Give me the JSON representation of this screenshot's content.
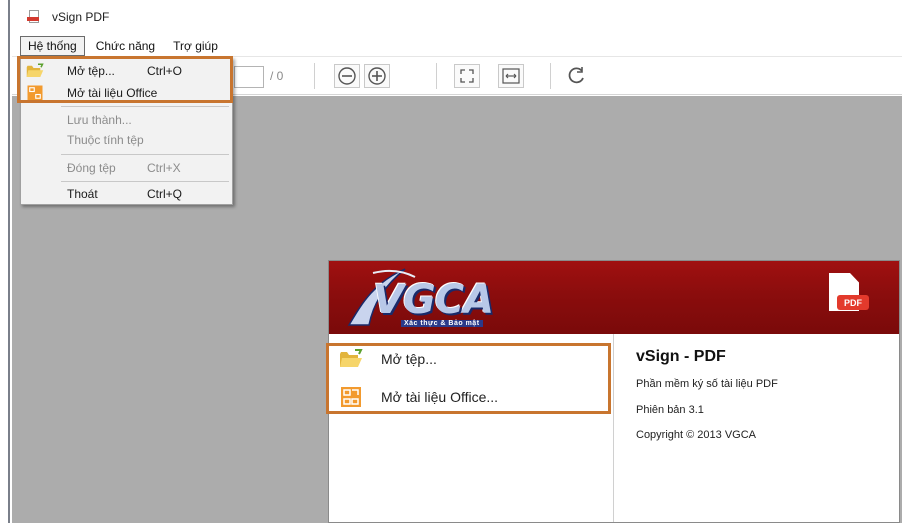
{
  "window": {
    "title": "vSign PDF"
  },
  "menubar": {
    "items": [
      "Hệ thống",
      "Chức năng",
      "Trợ giúp"
    ]
  },
  "toolbar": {
    "page_total": "/ 0"
  },
  "dropdown": {
    "open_item": "Mở tệp...",
    "open_shortcut": "Ctrl+O",
    "open_office": "Mở tài liệu Office",
    "save_as": "Lưu thành...",
    "properties": "Thuộc tính tệp",
    "close": "Đóng tệp",
    "close_shortcut": "Ctrl+X",
    "exit": "Thoát",
    "exit_shortcut": "Ctrl+Q"
  },
  "panel": {
    "logo_text": "VGCA",
    "logo_tagline": "Xác thực & Bảo mật",
    "pdf_badge": "PDF",
    "actions": {
      "open": "Mở tệp...",
      "open_office": "Mở tài liệu Office..."
    },
    "info": {
      "title": "vSign - PDF",
      "description": "Phần mềm ký số tài liệu PDF",
      "version": "Phiên bản 3.1",
      "copyright": "Copyright © 2013 VGCA"
    }
  },
  "colors": {
    "highlight": "#c8752f",
    "header_red": "#8b0d0d",
    "workspace": "#acacac",
    "pdf_red": "#e33a2c"
  },
  "icons": [
    "pdf-app-icon",
    "folder-open-icon",
    "office-doc-icon",
    "zoom-out-icon",
    "zoom-in-icon",
    "fit-page-icon",
    "fit-width-icon",
    "rotate-icon"
  ]
}
